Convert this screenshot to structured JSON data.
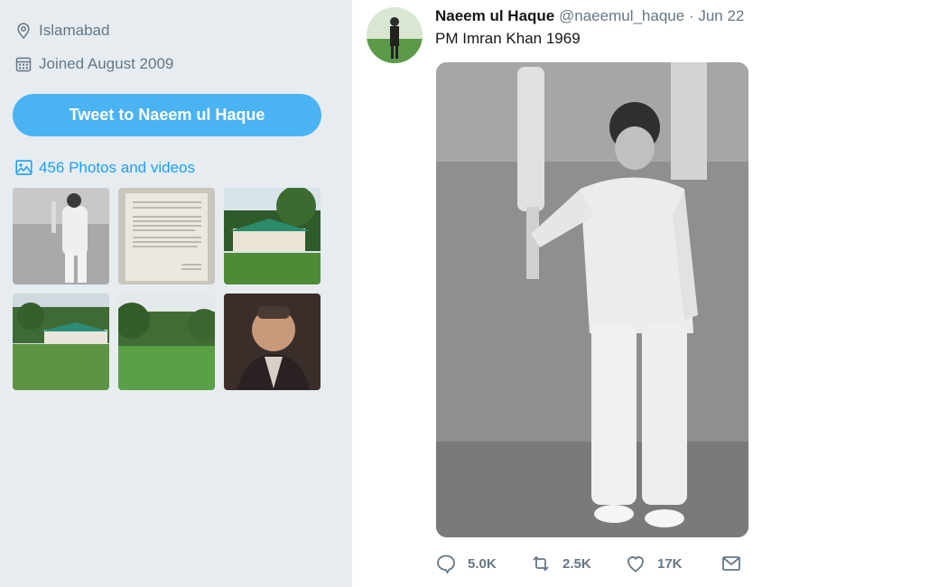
{
  "profile": {
    "location": "Islamabad",
    "joined": "Joined August 2009",
    "tweet_to_label": "Tweet to Naeem ul Haque",
    "photos_label": "456 Photos and videos"
  },
  "tweet": {
    "author_name": "Naeem ul Haque",
    "author_handle": "@naeemul_haque",
    "separator": "·",
    "date": "Jun 22",
    "text": "PM Imran Khan 1969",
    "replies": "5.0K",
    "retweets": "2.5K",
    "likes": "17K"
  },
  "icons": {
    "location": "location-pin-icon",
    "joined": "calendar-icon",
    "photos": "image-icon",
    "reply": "reply-icon",
    "retweet": "retweet-icon",
    "like": "heart-icon",
    "dm": "envelope-icon"
  },
  "colors": {
    "sidebar_bg": "#e6ecf0",
    "accent": "#1da1f2",
    "button_bg": "#4ab3f4",
    "muted": "#657786"
  }
}
